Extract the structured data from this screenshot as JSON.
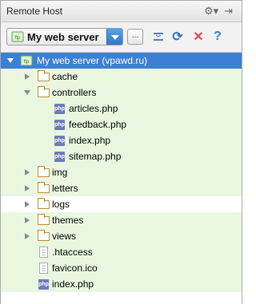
{
  "window": {
    "title": "Remote Host"
  },
  "toolbar": {
    "server": "My web server",
    "more_label": "..."
  },
  "tree": {
    "root": "My web server (vpawd.ru)",
    "items": [
      {
        "name": "cache"
      },
      {
        "name": "controllers"
      },
      {
        "name": "articles.php"
      },
      {
        "name": "feedback.php"
      },
      {
        "name": "index.php"
      },
      {
        "name": "sitemap.php"
      },
      {
        "name": "img"
      },
      {
        "name": "letters"
      },
      {
        "name": "logs"
      },
      {
        "name": "themes"
      },
      {
        "name": "views"
      },
      {
        "name": ".htaccess"
      },
      {
        "name": "favicon.ico"
      },
      {
        "name": "index.php"
      }
    ]
  },
  "icons": {
    "gear": "gear-icon",
    "pin": "pin-icon",
    "collapse": "collapse-all-icon",
    "refresh": "refresh-icon",
    "close": "close-icon",
    "help": "help-icon",
    "php": "php",
    "ftp": "ftp"
  },
  "colors": {
    "selection": "#3d7fd6",
    "modified": "#eaf7e0",
    "refresh": "#2f79c9",
    "close": "#e04b4b"
  }
}
